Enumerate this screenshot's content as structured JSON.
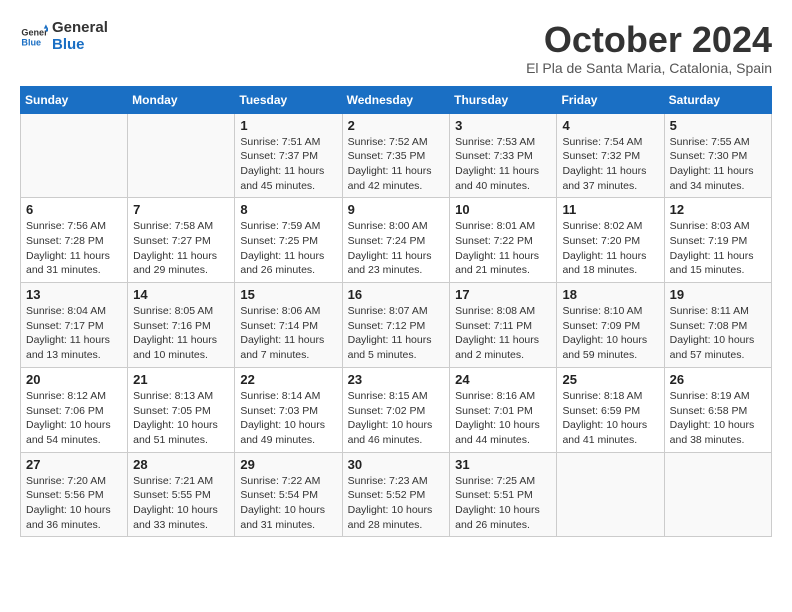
{
  "header": {
    "logo_line1": "General",
    "logo_line2": "Blue",
    "month": "October 2024",
    "location": "El Pla de Santa Maria, Catalonia, Spain"
  },
  "weekdays": [
    "Sunday",
    "Monday",
    "Tuesday",
    "Wednesday",
    "Thursday",
    "Friday",
    "Saturday"
  ],
  "weeks": [
    [
      {
        "day": "",
        "info": ""
      },
      {
        "day": "",
        "info": ""
      },
      {
        "day": "1",
        "info": "Sunrise: 7:51 AM\nSunset: 7:37 PM\nDaylight: 11 hours and 45 minutes."
      },
      {
        "day": "2",
        "info": "Sunrise: 7:52 AM\nSunset: 7:35 PM\nDaylight: 11 hours and 42 minutes."
      },
      {
        "day": "3",
        "info": "Sunrise: 7:53 AM\nSunset: 7:33 PM\nDaylight: 11 hours and 40 minutes."
      },
      {
        "day": "4",
        "info": "Sunrise: 7:54 AM\nSunset: 7:32 PM\nDaylight: 11 hours and 37 minutes."
      },
      {
        "day": "5",
        "info": "Sunrise: 7:55 AM\nSunset: 7:30 PM\nDaylight: 11 hours and 34 minutes."
      }
    ],
    [
      {
        "day": "6",
        "info": "Sunrise: 7:56 AM\nSunset: 7:28 PM\nDaylight: 11 hours and 31 minutes."
      },
      {
        "day": "7",
        "info": "Sunrise: 7:58 AM\nSunset: 7:27 PM\nDaylight: 11 hours and 29 minutes."
      },
      {
        "day": "8",
        "info": "Sunrise: 7:59 AM\nSunset: 7:25 PM\nDaylight: 11 hours and 26 minutes."
      },
      {
        "day": "9",
        "info": "Sunrise: 8:00 AM\nSunset: 7:24 PM\nDaylight: 11 hours and 23 minutes."
      },
      {
        "day": "10",
        "info": "Sunrise: 8:01 AM\nSunset: 7:22 PM\nDaylight: 11 hours and 21 minutes."
      },
      {
        "day": "11",
        "info": "Sunrise: 8:02 AM\nSunset: 7:20 PM\nDaylight: 11 hours and 18 minutes."
      },
      {
        "day": "12",
        "info": "Sunrise: 8:03 AM\nSunset: 7:19 PM\nDaylight: 11 hours and 15 minutes."
      }
    ],
    [
      {
        "day": "13",
        "info": "Sunrise: 8:04 AM\nSunset: 7:17 PM\nDaylight: 11 hours and 13 minutes."
      },
      {
        "day": "14",
        "info": "Sunrise: 8:05 AM\nSunset: 7:16 PM\nDaylight: 11 hours and 10 minutes."
      },
      {
        "day": "15",
        "info": "Sunrise: 8:06 AM\nSunset: 7:14 PM\nDaylight: 11 hours and 7 minutes."
      },
      {
        "day": "16",
        "info": "Sunrise: 8:07 AM\nSunset: 7:12 PM\nDaylight: 11 hours and 5 minutes."
      },
      {
        "day": "17",
        "info": "Sunrise: 8:08 AM\nSunset: 7:11 PM\nDaylight: 11 hours and 2 minutes."
      },
      {
        "day": "18",
        "info": "Sunrise: 8:10 AM\nSunset: 7:09 PM\nDaylight: 10 hours and 59 minutes."
      },
      {
        "day": "19",
        "info": "Sunrise: 8:11 AM\nSunset: 7:08 PM\nDaylight: 10 hours and 57 minutes."
      }
    ],
    [
      {
        "day": "20",
        "info": "Sunrise: 8:12 AM\nSunset: 7:06 PM\nDaylight: 10 hours and 54 minutes."
      },
      {
        "day": "21",
        "info": "Sunrise: 8:13 AM\nSunset: 7:05 PM\nDaylight: 10 hours and 51 minutes."
      },
      {
        "day": "22",
        "info": "Sunrise: 8:14 AM\nSunset: 7:03 PM\nDaylight: 10 hours and 49 minutes."
      },
      {
        "day": "23",
        "info": "Sunrise: 8:15 AM\nSunset: 7:02 PM\nDaylight: 10 hours and 46 minutes."
      },
      {
        "day": "24",
        "info": "Sunrise: 8:16 AM\nSunset: 7:01 PM\nDaylight: 10 hours and 44 minutes."
      },
      {
        "day": "25",
        "info": "Sunrise: 8:18 AM\nSunset: 6:59 PM\nDaylight: 10 hours and 41 minutes."
      },
      {
        "day": "26",
        "info": "Sunrise: 8:19 AM\nSunset: 6:58 PM\nDaylight: 10 hours and 38 minutes."
      }
    ],
    [
      {
        "day": "27",
        "info": "Sunrise: 7:20 AM\nSunset: 5:56 PM\nDaylight: 10 hours and 36 minutes."
      },
      {
        "day": "28",
        "info": "Sunrise: 7:21 AM\nSunset: 5:55 PM\nDaylight: 10 hours and 33 minutes."
      },
      {
        "day": "29",
        "info": "Sunrise: 7:22 AM\nSunset: 5:54 PM\nDaylight: 10 hours and 31 minutes."
      },
      {
        "day": "30",
        "info": "Sunrise: 7:23 AM\nSunset: 5:52 PM\nDaylight: 10 hours and 28 minutes."
      },
      {
        "day": "31",
        "info": "Sunrise: 7:25 AM\nSunset: 5:51 PM\nDaylight: 10 hours and 26 minutes."
      },
      {
        "day": "",
        "info": ""
      },
      {
        "day": "",
        "info": ""
      }
    ]
  ]
}
